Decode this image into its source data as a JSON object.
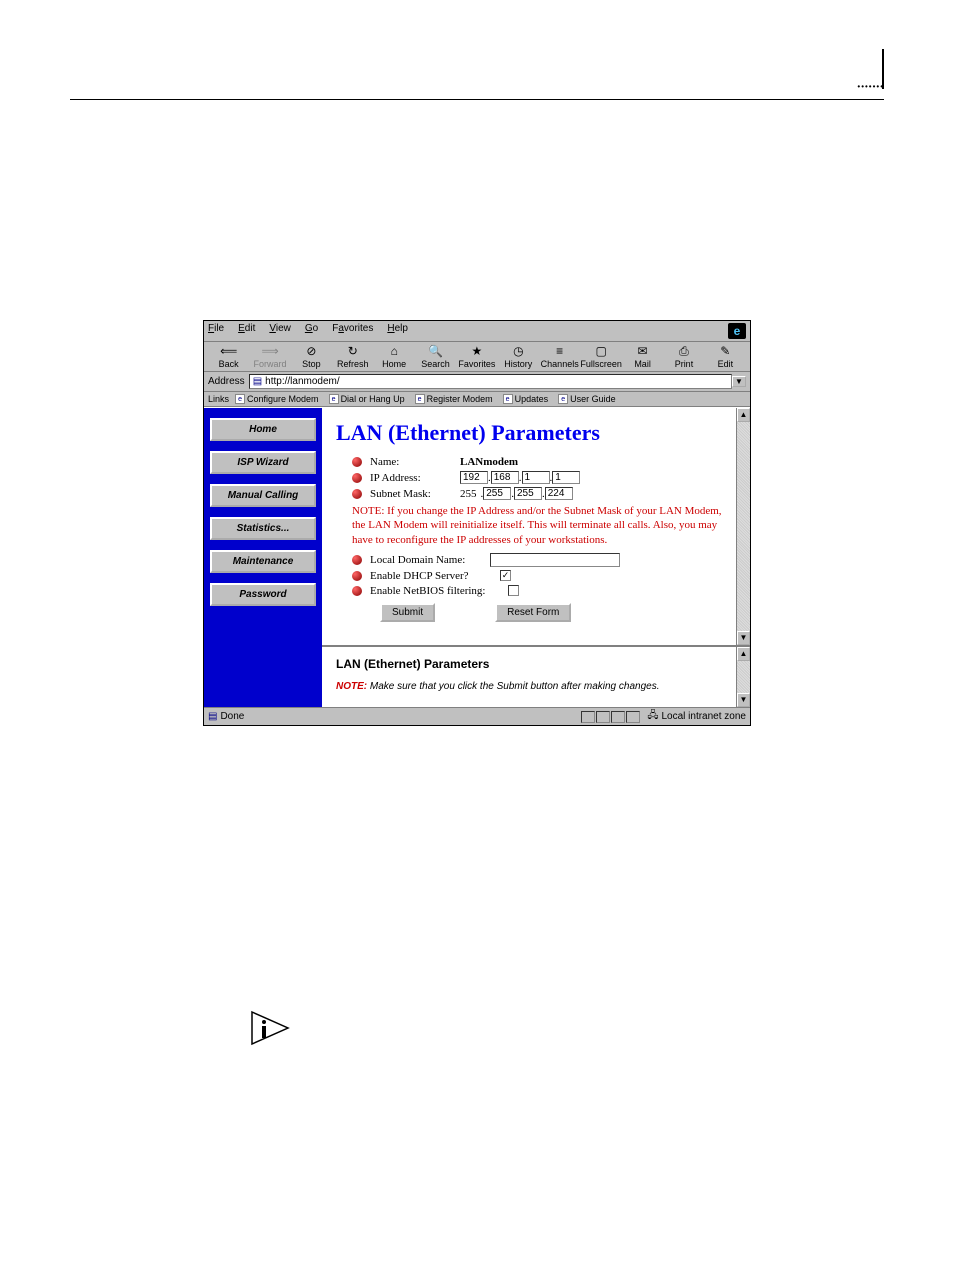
{
  "menubar": {
    "items": [
      "File",
      "Edit",
      "View",
      "Go",
      "Favorites",
      "Help"
    ]
  },
  "toolbar": {
    "items": [
      {
        "label": "Back",
        "key": "back"
      },
      {
        "label": "Forward",
        "key": "forward"
      },
      {
        "label": "Stop",
        "key": "stop"
      },
      {
        "label": "Refresh",
        "key": "refresh"
      },
      {
        "label": "Home",
        "key": "home"
      },
      {
        "label": "Search",
        "key": "search"
      },
      {
        "label": "Favorites",
        "key": "favorites"
      },
      {
        "label": "History",
        "key": "history"
      },
      {
        "label": "Channels",
        "key": "channels"
      },
      {
        "label": "Fullscreen",
        "key": "fullscreen"
      },
      {
        "label": "Mail",
        "key": "mail"
      },
      {
        "label": "Print",
        "key": "print"
      },
      {
        "label": "Edit",
        "key": "edit"
      }
    ]
  },
  "addressbar": {
    "label": "Address",
    "url": "http://lanmodem/"
  },
  "linksbar": {
    "label": "Links",
    "items": [
      "Configure Modem",
      "Dial or Hang Up",
      "Register Modem",
      "Updates",
      "User Guide"
    ]
  },
  "sidebar": {
    "items": [
      "Home",
      "ISP Wizard",
      "Manual Calling",
      "Statistics...",
      "Maintenance",
      "Password"
    ]
  },
  "page": {
    "title": "LAN (Ethernet) Parameters",
    "name_label": "Name:",
    "name_value": "LANmodem",
    "ip_label": "IP Address:",
    "ip": [
      "192",
      "168",
      "1",
      "1"
    ],
    "mask_label": "Subnet Mask:",
    "mask_prefix": "255",
    "mask": [
      "255",
      "255",
      "224"
    ],
    "note_red": "NOTE: If you change the IP Address and/or the Subnet Mask of your LAN Modem, the LAN Modem will reinitialize itself. This will terminate all calls. Also, you may have to reconfigure the IP addresses of your workstations.",
    "local_domain_label": "Local Domain Name:",
    "local_domain_value": "",
    "dhcp_label": "Enable DHCP Server?",
    "dhcp_checked": true,
    "netbios_label": "Enable NetBIOS filtering:",
    "netbios_checked": false,
    "submit": "Submit",
    "reset": "Reset Form"
  },
  "lower": {
    "heading": "LAN (Ethernet) Parameters",
    "note_prefix": "NOTE:",
    "note_text": " Make sure that you click the Submit button after making changes."
  },
  "statusbar": {
    "status": "Done",
    "zone": "Local intranet zone"
  }
}
